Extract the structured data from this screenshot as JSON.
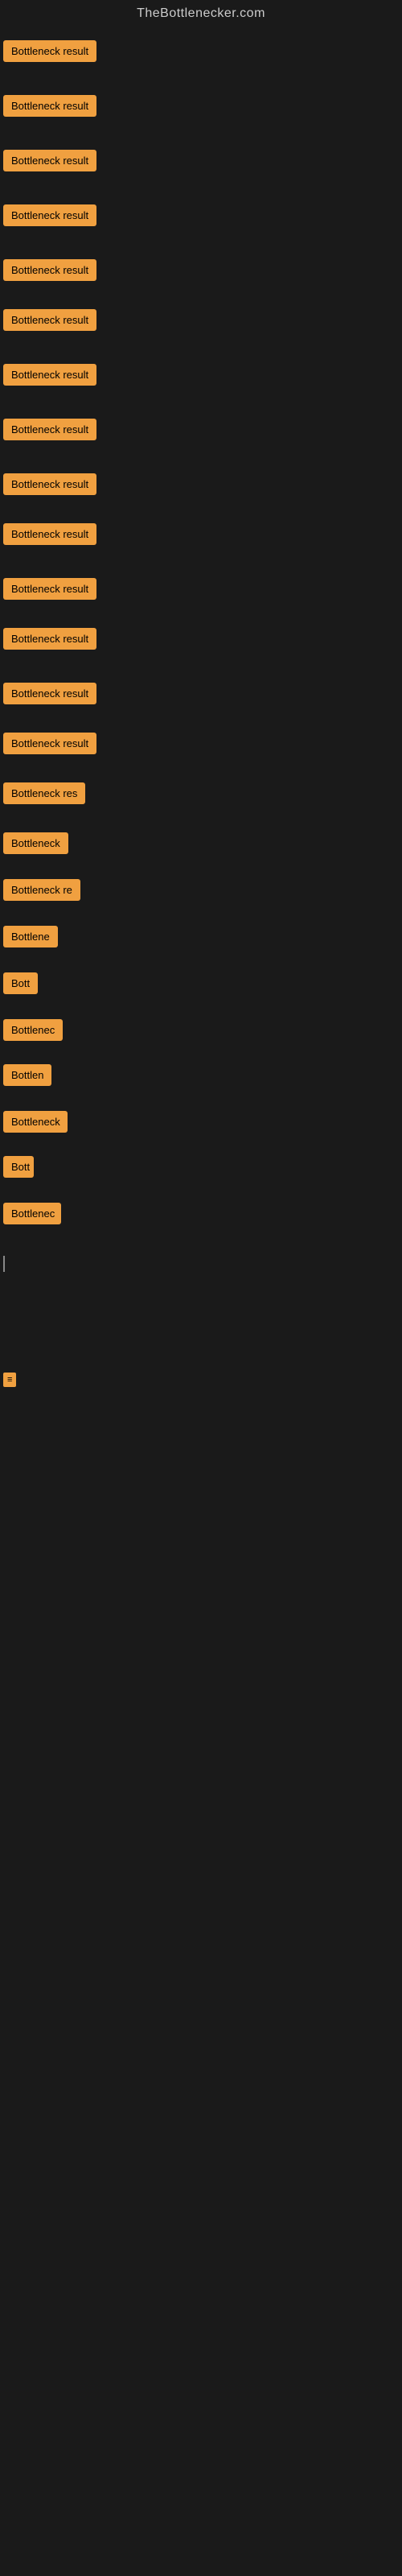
{
  "site": {
    "title": "TheBottlenecker.com"
  },
  "bottleneck_rows": [
    {
      "id": 1,
      "label": "Bottleneck result",
      "width": 130,
      "margin_top": 8
    },
    {
      "id": 2,
      "label": "Bottleneck result",
      "width": 130,
      "margin_top": 28
    },
    {
      "id": 3,
      "label": "Bottleneck result",
      "width": 130,
      "margin_top": 28
    },
    {
      "id": 4,
      "label": "Bottleneck result",
      "width": 130,
      "margin_top": 28
    },
    {
      "id": 5,
      "label": "Bottleneck result",
      "width": 130,
      "margin_top": 28
    },
    {
      "id": 6,
      "label": "Bottleneck result",
      "width": 130,
      "margin_top": 22
    },
    {
      "id": 7,
      "label": "Bottleneck result",
      "width": 130,
      "margin_top": 28
    },
    {
      "id": 8,
      "label": "Bottleneck result",
      "width": 130,
      "margin_top": 28
    },
    {
      "id": 9,
      "label": "Bottleneck result",
      "width": 130,
      "margin_top": 28
    },
    {
      "id": 10,
      "label": "Bottleneck result",
      "width": 130,
      "margin_top": 22
    },
    {
      "id": 11,
      "label": "Bottleneck result",
      "width": 130,
      "margin_top": 28
    },
    {
      "id": 12,
      "label": "Bottleneck result",
      "width": 130,
      "margin_top": 22
    },
    {
      "id": 13,
      "label": "Bottleneck result",
      "width": 130,
      "margin_top": 28
    },
    {
      "id": 14,
      "label": "Bottleneck result",
      "width": 130,
      "margin_top": 22
    },
    {
      "id": 15,
      "label": "Bottleneck res",
      "width": 112,
      "margin_top": 22
    },
    {
      "id": 16,
      "label": "Bottleneck",
      "width": 85,
      "margin_top": 22
    },
    {
      "id": 17,
      "label": "Bottleneck re",
      "width": 100,
      "margin_top": 18
    },
    {
      "id": 18,
      "label": "Bottlene",
      "width": 72,
      "margin_top": 18
    },
    {
      "id": 19,
      "label": "Bott",
      "width": 44,
      "margin_top": 18
    },
    {
      "id": 20,
      "label": "Bottlenec",
      "width": 74,
      "margin_top": 18
    },
    {
      "id": 21,
      "label": "Bottlen",
      "width": 62,
      "margin_top": 16
    },
    {
      "id": 22,
      "label": "Bottleneck",
      "width": 80,
      "margin_top": 18
    },
    {
      "id": 23,
      "label": "Bott",
      "width": 38,
      "margin_top": 16
    },
    {
      "id": 24,
      "label": "Bottlenec",
      "width": 72,
      "margin_top": 18
    }
  ],
  "bottom_elements": {
    "cursor_visible": true,
    "tiny_badge_label": "≡"
  }
}
